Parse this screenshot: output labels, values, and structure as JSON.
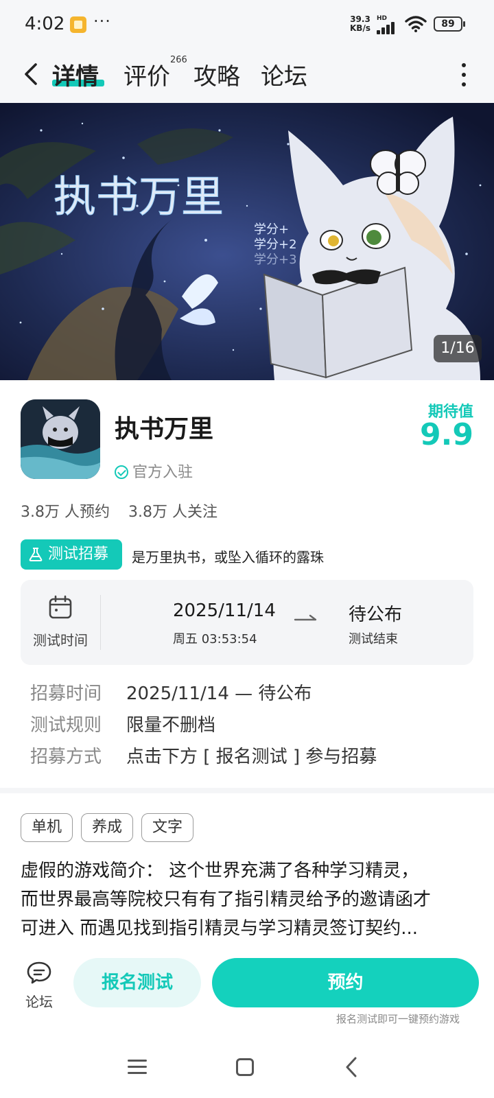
{
  "status_bar": {
    "time": "4:02",
    "more": "···",
    "net_speed_value": "39.3",
    "net_speed_unit": "KB/s",
    "hd": "HD",
    "battery": "89"
  },
  "nav": {
    "tabs": [
      {
        "label": "详情",
        "active": true
      },
      {
        "label": "评价",
        "badge": "266"
      },
      {
        "label": "攻略"
      },
      {
        "label": "论坛"
      }
    ]
  },
  "banner": {
    "title_art": "执书万里",
    "art_subtext": [
      "学分+",
      "学分+2",
      "学分+3"
    ],
    "counter": "1/16"
  },
  "app": {
    "title": "执书万里",
    "verified": "官方入驻",
    "expect_label": "期待值",
    "expect_value": "9.9",
    "reservations": "3.8万 人预约",
    "followers": "3.8万 人关注"
  },
  "recruit": {
    "badge": "测试招募",
    "slogan": "是万里执书，或坠入循环的露珠"
  },
  "test_card": {
    "label": "测试时间",
    "start_date": "2025/11/14",
    "start_sub": "周五  03:53:54",
    "end_value": "待公布",
    "end_sub": "测试结束"
  },
  "details": [
    {
      "key": "招募时间",
      "value": "2025/11/14 — 待公布"
    },
    {
      "key": "测试规则",
      "value": "限量不删档"
    },
    {
      "key": "招募方式",
      "value": "点击下方 [ 报名测试 ] 参与招募"
    }
  ],
  "tags": [
    "单机",
    "养成",
    "文字"
  ],
  "description": [
    "虚假的游戏简介：  这个世界充满了各种学习精灵，",
    "而世界最高等院校只有有了指引精灵给予的邀请函才",
    "可进入 而遇见找到指引精灵与学习精灵签订契约..."
  ],
  "actions": {
    "forum": "论坛",
    "signup": "报名测试",
    "reserve": "预约",
    "hint": "报名测试即可一键预约游戏"
  },
  "colors": {
    "accent": "#14c9b8",
    "reserve_button": "#14d1bd",
    "signup_button_bg": "#e6f8f7"
  }
}
